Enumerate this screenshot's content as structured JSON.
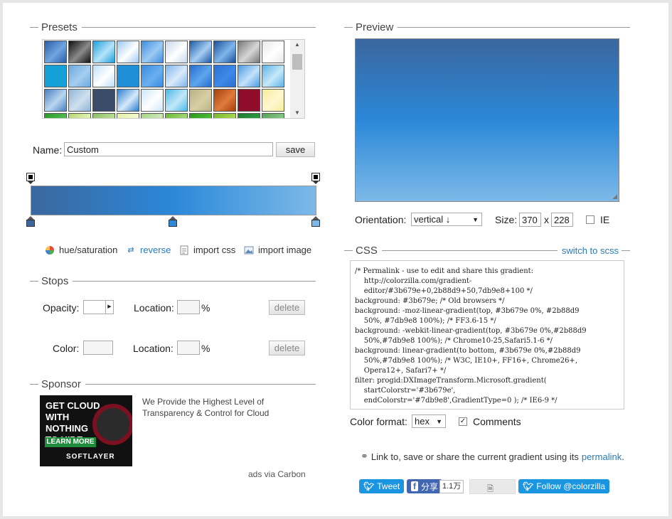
{
  "presets": {
    "title": "Presets",
    "swatches": [
      [
        "#2a5da8",
        "#6fa6df"
      ],
      [
        "#111111",
        "#8a8a8a"
      ],
      [
        "#1d9fdc",
        "#b5e3f8"
      ],
      [
        "#9cc9ee",
        "#ffffff"
      ],
      [
        "#3f8de0",
        "#9ccaf3"
      ],
      [
        "#c9d7e8",
        "#ffffff"
      ],
      [
        "#1a5ca6",
        "#a6cdf1"
      ],
      [
        "#1b4f9b",
        "#7fb7ea"
      ],
      [
        "#777777",
        "#d6d6d6"
      ],
      [
        "#e8e8e8",
        "#ffffff"
      ],
      [
        "#16a0d8",
        "#16a0d8"
      ],
      [
        "#6aaadf",
        "#a6cdf0"
      ],
      [
        "#bddff7",
        "#ffffff"
      ],
      [
        "#1f8fd8",
        "#1f8fd8"
      ],
      [
        "#3a8ae0",
        "#6ab0ee"
      ],
      [
        "#7fb5ea",
        "#d9ebfa"
      ],
      [
        "#256dcf",
        "#5ea6ec"
      ],
      [
        "#2d6fd2",
        "#3d8ae8"
      ],
      [
        "#4a9be5",
        "#c3e2f9"
      ],
      [
        "#5ab4e8",
        "#c6e8f8"
      ],
      [
        "#4a80c0",
        "#b9d6f0"
      ],
      [
        "#8fb5d6",
        "#cfe0ee"
      ],
      [
        "#3a4c6a",
        "#3a4c6a"
      ],
      [
        "#2b7fd1",
        "#d5e9f8"
      ],
      [
        "#cde6f7",
        "#ffffff"
      ],
      [
        "#4cb8e8",
        "#c2e8f8"
      ],
      [
        "#bab184",
        "#d8cfa6"
      ],
      [
        "#a4420d",
        "#e07a3c"
      ],
      [
        "#8f0d2a",
        "#8f0d2a"
      ],
      [
        "#f6ec9a",
        "#fff8d0"
      ],
      [
        "#2a9a2a",
        "#4fba4f"
      ],
      [
        "#b5d66f",
        "#e2f2b3"
      ],
      [
        "#8cc064",
        "#b9dd93"
      ],
      [
        "#e3f0a1",
        "#f3f9d0"
      ],
      [
        "#a6d486",
        "#cfe8b8"
      ],
      [
        "#6cbb3c",
        "#9ed66e"
      ],
      [
        "#2a9a1d",
        "#4aba32"
      ],
      [
        "#79b82b",
        "#a8d552"
      ],
      [
        "#1e7a2e",
        "#2a9b3e"
      ],
      [
        "#5aa35a",
        "#85c585"
      ]
    ]
  },
  "name": {
    "label": "Name:",
    "value": "Custom",
    "save": "save"
  },
  "gradient": {
    "stops": [
      "#3b679e",
      "#2b88d9",
      "#7db9e8"
    ],
    "positions": [
      0,
      50,
      100
    ]
  },
  "tools": {
    "hue": "hue/saturation",
    "reverse": "reverse",
    "import_css": "import css",
    "import_image": "import image"
  },
  "stops": {
    "title": "Stops",
    "opacity_label": "Opacity:",
    "location_label": "Location:",
    "percent": "%",
    "color_label": "Color:",
    "delete": "delete"
  },
  "sponsor": {
    "title": "Sponsor",
    "ad_headline": "GET CLOUD\nWITH NOTHING\nTO HIDE.",
    "ad_cta": "LEARN MORE",
    "ad_brand": "SOFTLAYER",
    "text": "We Provide the Highest Level of Transparency & Control for Cloud",
    "via": "ads via Carbon"
  },
  "preview": {
    "title": "Preview",
    "orientation_label": "Orientation:",
    "orientation_value": "vertical  ↓",
    "size_label": "Size:",
    "width": "370",
    "x": "x",
    "height": "228",
    "ie_label": "IE"
  },
  "css": {
    "title": "CSS",
    "switch": "switch to scss",
    "code": "/* Permalink - use to edit and share this gradient:\n    http://colorzilla.com/gradient-\n    editor/#3b679e+0,2b88d9+50,7db9e8+100 */\nbackground: #3b679e; /* Old browsers */\nbackground: -moz-linear-gradient(top, #3b679e 0%, #2b88d9\n    50%, #7db9e8 100%); /* FF3.6-15 */\nbackground: -webkit-linear-gradient(top, #3b679e 0%,#2b88d9\n    50%,#7db9e8 100%); /* Chrome10-25,Safari5.1-6 */\nbackground: linear-gradient(to bottom, #3b679e 0%,#2b88d9\n    50%,#7db9e8 100%); /* W3C, IE10+, FF16+, Chrome26+,\n    Opera12+, Safari7+ */\nfilter: progid:DXImageTransform.Microsoft.gradient(\n    startColorstr='#3b679e',\n    endColorstr='#7db9e8',GradientType=0 ); /* IE6-9 */",
    "format_label": "Color format:",
    "format_value": "hex",
    "comments_label": "Comments"
  },
  "permalink": {
    "text": "Link to, save or share the current gradient using its",
    "link": "permalink",
    "end": "."
  },
  "social": {
    "tweet": "Tweet",
    "share": "分享",
    "count": "1.1万",
    "follow": "Follow @colorzilla"
  }
}
